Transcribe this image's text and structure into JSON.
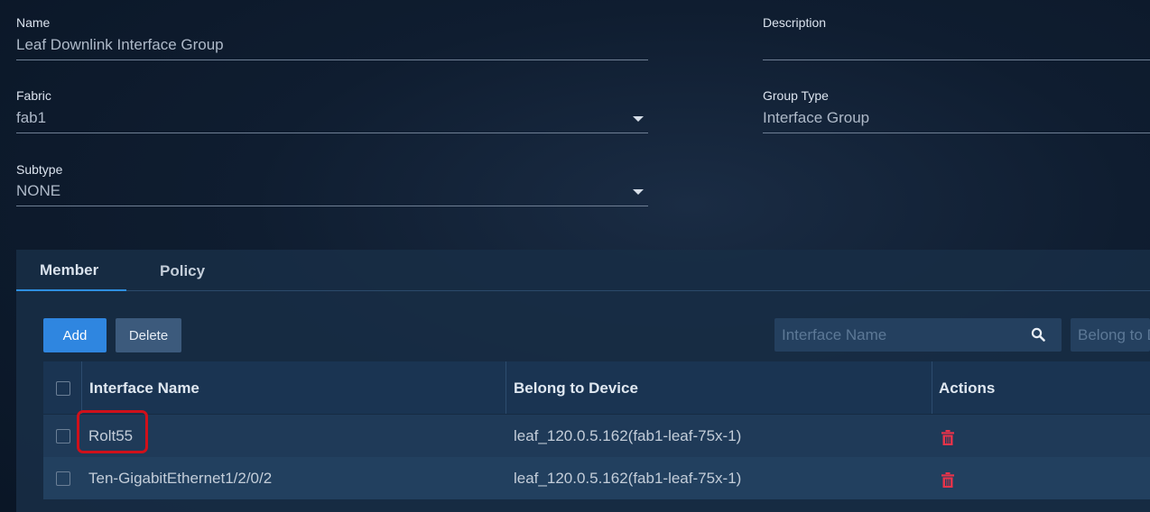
{
  "form": {
    "name": {
      "label": "Name",
      "value": "Leaf Downlink Interface Group"
    },
    "description": {
      "label": "Description",
      "value": ""
    },
    "fabric": {
      "label": "Fabric",
      "value": "fab1",
      "icon": "chevron-down-icon"
    },
    "group_type": {
      "label": "Group Type",
      "value": "Interface Group"
    },
    "subtype": {
      "label": "Subtype",
      "value": "NONE",
      "icon": "chevron-down-icon"
    }
  },
  "tabs": [
    {
      "label": "Member",
      "active": true
    },
    {
      "label": "Policy",
      "active": false
    }
  ],
  "toolbar": {
    "add_label": "Add",
    "delete_label": "Delete",
    "search_interface_placeholder": "Interface Name",
    "search_device_placeholder": "Belong to Device"
  },
  "table": {
    "columns": [
      "Interface Name",
      "Belong to Device",
      "Actions"
    ],
    "rows": [
      {
        "interface": "Rolt55",
        "device": "leaf_120.0.5.162(fab1-leaf-75x-1)",
        "action_icon": "trash-icon"
      },
      {
        "interface": "Ten-GigabitEthernet1/2/0/2",
        "device": "leaf_120.0.5.162(fab1-leaf-75x-1)",
        "action_icon": "trash-icon"
      }
    ]
  },
  "colors": {
    "primary": "#2f86e0",
    "danger": "#e8334a",
    "highlight": "#d0101a",
    "panel": "#182d46"
  }
}
